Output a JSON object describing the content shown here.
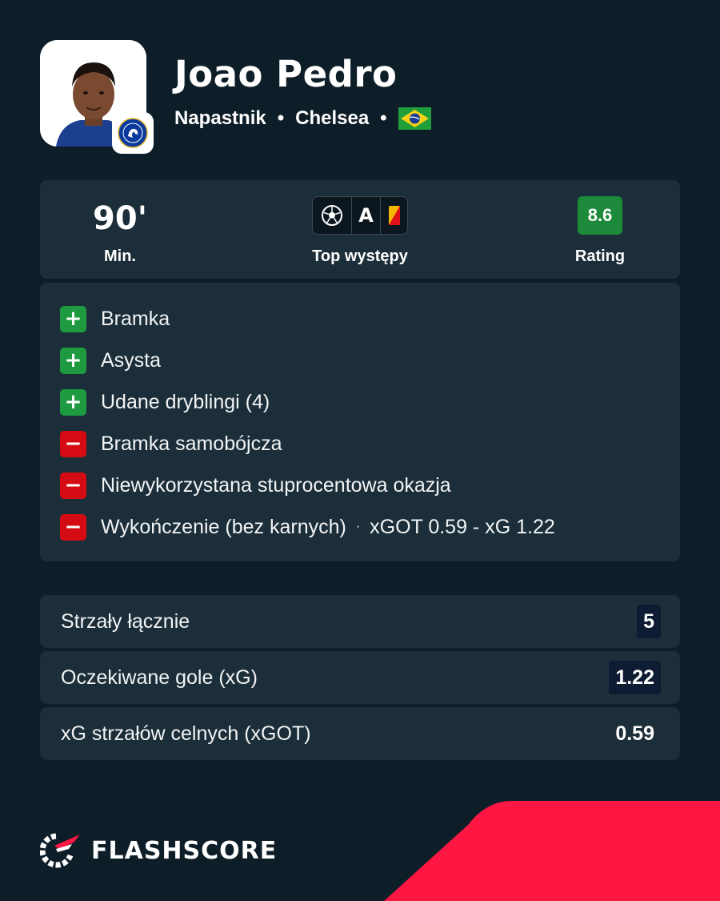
{
  "player": {
    "name": "Joao Pedro",
    "position": "Napastnik",
    "separator": "•",
    "club": "Chelsea",
    "nationality_flag": "brazil-flag"
  },
  "summary": {
    "minutes_value": "90'",
    "minutes_label": "Min.",
    "top_label": "Top występy",
    "assist_letter": "A",
    "rating_value": "8.6",
    "rating_label": "Rating"
  },
  "events": [
    {
      "type": "plus",
      "sign": "+",
      "label": "Bramka"
    },
    {
      "type": "plus",
      "sign": "+",
      "label": "Asysta"
    },
    {
      "type": "plus",
      "sign": "+",
      "label": "Udane dryblingi (4)"
    },
    {
      "type": "minus",
      "sign": "−",
      "label": "Bramka samobójcza"
    },
    {
      "type": "minus",
      "sign": "−",
      "label": "Niewykorzystana stuprocentowa okazja"
    },
    {
      "type": "minus",
      "sign": "−",
      "label": "Wykończenie (bez karnych)",
      "sep": "·",
      "detail": "xGOT 0.59 - xG 1.22"
    }
  ],
  "stats": [
    {
      "label": "Strzały łącznie",
      "value": "5"
    },
    {
      "label": "Oczekiwane gole (xG)",
      "value": "1.22"
    },
    {
      "label": "xG strzałów celnych (xGOT)",
      "value": "0.59"
    }
  ],
  "brand": {
    "name": "FLASHSCORE"
  },
  "colors": {
    "background": "#0e1e28",
    "card": "#1c2e39",
    "positive": "#1e9a41",
    "negative": "#d40b12",
    "rating": "#1d8a3b",
    "accent": "#ff1744"
  }
}
